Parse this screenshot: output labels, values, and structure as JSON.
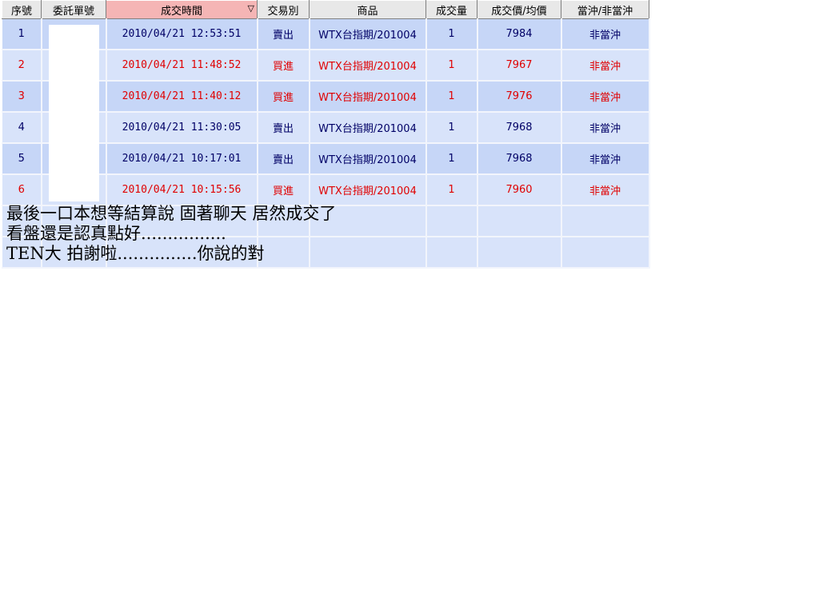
{
  "table": {
    "headers": {
      "seq": "序號",
      "order_no": "委託單號",
      "time": "成交時間",
      "time_sort_icon": "▽",
      "side": "交易別",
      "product": "商品",
      "qty": "成交量",
      "price": "成交價/均價",
      "daytrade": "當沖/非當沖"
    },
    "rows": [
      {
        "seq": "1",
        "time": "2010/04/21 12:53:51",
        "side": "賣出",
        "product": "WTX台指期/201004",
        "qty": "1",
        "price": "7984",
        "daytrade": "非當沖"
      },
      {
        "seq": "2",
        "time": "2010/04/21 11:48:52",
        "side": "買進",
        "product": "WTX台指期/201004",
        "qty": "1",
        "price": "7967",
        "daytrade": "非當沖"
      },
      {
        "seq": "3",
        "time": "2010/04/21 11:40:12",
        "side": "買進",
        "product": "WTX台指期/201004",
        "qty": "1",
        "price": "7976",
        "daytrade": "非當沖"
      },
      {
        "seq": "4",
        "time": "2010/04/21 11:30:05",
        "side": "賣出",
        "product": "WTX台指期/201004",
        "qty": "1",
        "price": "7968",
        "daytrade": "非當沖"
      },
      {
        "seq": "5",
        "time": "2010/04/21 10:17:01",
        "side": "賣出",
        "product": "WTX台指期/201004",
        "qty": "1",
        "price": "7968",
        "daytrade": "非當沖"
      },
      {
        "seq": "6",
        "time": "2010/04/21 10:15:56",
        "side": "買進",
        "product": "WTX台指期/201004",
        "qty": "1",
        "price": "7960",
        "daytrade": "非當沖"
      }
    ]
  },
  "notes": {
    "line1": "最後一口本想等結算說   固著聊天  居然成交了",
    "line2": "看盤還是認真點好................",
    "line3": "TEN大  拍謝啦...............你說的對"
  },
  "colors": {
    "sell_text": "#000066",
    "buy_text": "#e00000",
    "sorted_header_bg": "#f5b5b5",
    "row_even_bg": "#c6d6f7",
    "row_odd_bg": "#d8e3fa"
  }
}
